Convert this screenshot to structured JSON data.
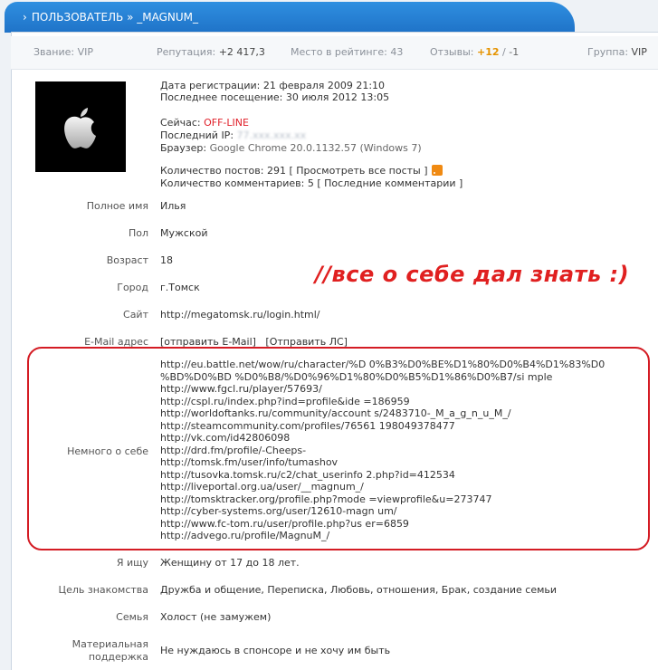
{
  "header": {
    "chevron": "›",
    "title": "ПОЛЬЗОВАТЕЛЬ » _MAGNUM_"
  },
  "stats": {
    "rank_label": "Звание:",
    "rank_value": "VIP",
    "rep_label": "Репутация:",
    "rep_value": "+2 417,3",
    "place_label": "Место в рейтинге:",
    "place_value": "43",
    "reviews_label": "Отзывы:",
    "reviews_pos": "+12",
    "reviews_sep": "/",
    "reviews_neg": "-1",
    "group_label": "Группа:",
    "group_value": "VIP"
  },
  "profile": {
    "reg": "Дата регистрации: 21 февраля 2009 21:10",
    "last_visit": "Последнее посещение: 30 июля 2012 13:05",
    "now_label": "Сейчас:",
    "now_value": "OFF-LINE",
    "ip_label": "Последний IP:",
    "ip_value": "77.xxx.xxx.xx",
    "browser_label": "Браузер:",
    "browser_value": "Google Chrome 20.0.1132.57 (Windows 7)",
    "posts_label": "Количество постов: 291",
    "posts_link": "[ Просмотреть все посты ]",
    "comments_label": "Количество комментариев: 5",
    "comments_link": "[ Последние комментарии ]"
  },
  "fields": {
    "name_label": "Полное имя",
    "name_value": "Илья",
    "sex_label": "Пол",
    "sex_value": "Мужской",
    "age_label": "Возраст",
    "age_value": "18",
    "city_label": "Город",
    "city_value": "г.Томск",
    "site_label": "Сайт",
    "site_value": "http://megatomsk.ru/login.html/",
    "email_label": "E-Mail адрес",
    "email_link": "[отправить E-Mail]",
    "pm_link": "[Отправить ЛС]",
    "about_label": "Немного о себе",
    "seek_label": "Я ищу",
    "seek_value": "Женщину от 17 до 18 лет.",
    "goal_label": "Цель знакомства",
    "goal_value": "Дружба и общение, Переписка, Любовь, отношения, Брак, создание семьи",
    "family_label": "Семья",
    "family_value": "Холост (не замужем)",
    "support_label1": "Материальная",
    "support_label2": "поддержка",
    "support_value": "Не нуждаюсь в спонсоре и не хочу им быть"
  },
  "about_lines": [
    "http://eu.battle.net/wow/ru/character/%D 0%B3%D0%BE%D1%80%D0%B4%D1%83%D0",
    "%BD%D0%BD %D0%B8/%D0%96%D1%80%D0%B5%D1%86%D0%B7/si mple",
    "http://www.fgcl.ru/player/57693/",
    "http://cspl.ru/index.php?ind=profile&ide =186959",
    "http://worldoftanks.ru/community/account s/2483710-_M_a_g_n_u_M_/",
    "http://steamcommunity.com/profiles/76561 198049378477",
    "http://vk.com/id42806098",
    "http://drd.fm/profile/-Cheeps-",
    "http://tomsk.fm/user/info/tumashov",
    "http://tusovka.tomsk.ru/c2/chat_userinfo 2.php?id=412534",
    "http://liveportal.org.ua/user/__magnum_/",
    "http://tomsktracker.org/profile.php?mode =viewprofile&u=273747",
    "http://cyber-systems.org/user/12610-magn um/",
    "http://www.fc-tom.ru/user/profile.php?us er=6859",
    "http://advego.ru/profile/MagnuM_/"
  ],
  "annotation": "//все о себе дал знать :)",
  "colors": {
    "header_blue": "#2f8fe0",
    "annotation_red": "#e02020",
    "offline_red": "#e0202a",
    "positive_orange": "#e59300"
  }
}
